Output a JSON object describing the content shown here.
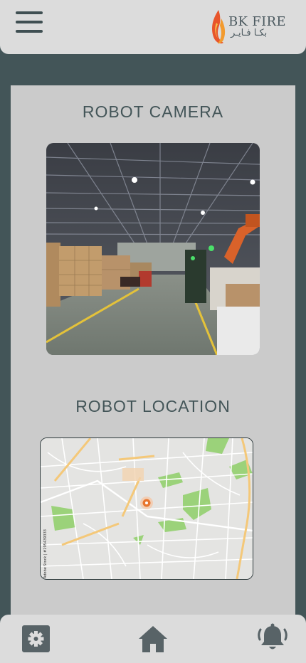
{
  "header": {
    "menu_icon": "hamburger-menu-icon",
    "logo": {
      "text_en": "BK FIRE",
      "text_ar": "بكـا فـايـر"
    }
  },
  "camera_section": {
    "title": "ROBOT CAMERA",
    "image": "warehouse-camera-feed"
  },
  "location_section": {
    "title": "ROBOT LOCATION",
    "image": "city-street-map",
    "watermark": "Adobe Stock | #195439333"
  },
  "bottom_nav": {
    "items": [
      {
        "icon": "settings-gear-icon"
      },
      {
        "icon": "home-icon"
      },
      {
        "icon": "notification-bell-icon"
      }
    ]
  },
  "colors": {
    "background": "#435558",
    "bars": "#dcdcdc",
    "panel": "#cbcbcb",
    "title_text": "#435558",
    "map_marker": "#e8752e"
  }
}
